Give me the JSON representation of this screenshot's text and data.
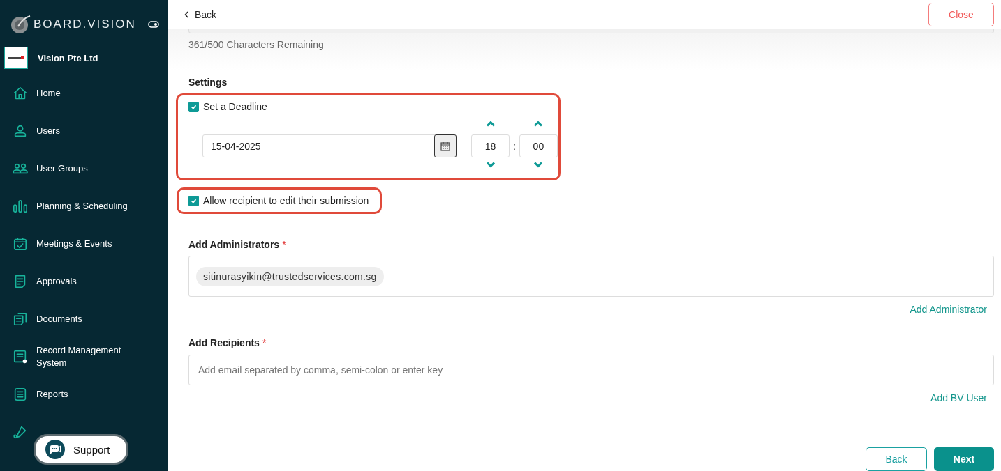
{
  "sidebar": {
    "brand": "BOARD.VISION",
    "org": "Vision Pte Ltd",
    "items": [
      {
        "label": "Home"
      },
      {
        "label": "Users"
      },
      {
        "label": "User Groups"
      },
      {
        "label": "Planning & Scheduling"
      },
      {
        "label": "Meetings & Events"
      },
      {
        "label": "Approvals"
      },
      {
        "label": "Documents"
      },
      {
        "label": "Record Management System"
      },
      {
        "label": "Reports"
      }
    ]
  },
  "support": {
    "label": "Support"
  },
  "header": {
    "back": "Back",
    "close": "Close"
  },
  "description": {
    "counter": "361/500 Characters Remaining"
  },
  "settings": {
    "title": "Settings",
    "deadline": {
      "label": "Set a Deadline",
      "checked": true,
      "highlighted": true,
      "date": "15-04-2025",
      "hour": "18",
      "separator": ":",
      "minute": "00"
    },
    "allow_edit": {
      "label": "Allow recipient to edit their submission",
      "checked": true,
      "highlighted": true
    }
  },
  "administrators": {
    "label": "Add Administrators",
    "required_mark": "*",
    "chips": [
      "sitinurasyikin@trustedservices.com.sg"
    ],
    "link": "Add Administrator"
  },
  "recipients": {
    "label": "Add Recipients",
    "required_mark": "*",
    "placeholder": "Add email separated by comma, semi-colon or enter key",
    "link": "Add BV User"
  },
  "footer": {
    "back": "Back",
    "next": "Next"
  }
}
